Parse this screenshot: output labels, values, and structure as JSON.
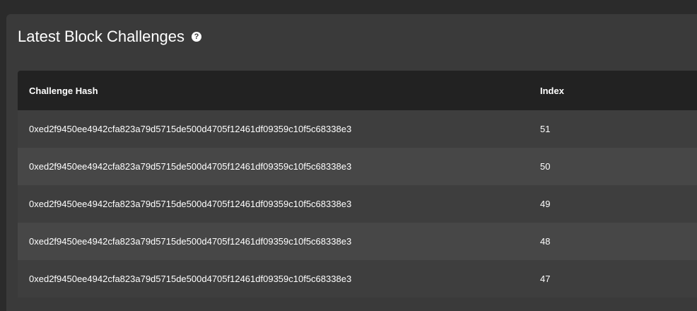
{
  "panel": {
    "title": "Latest Block Challenges",
    "help_icon": "question-circle-icon"
  },
  "table": {
    "columns": [
      "Challenge Hash",
      "Index"
    ],
    "rows": [
      {
        "hash": "0xed2f9450ee4942cfa823a79d5715de500d4705f12461df09359c10f5c68338e3",
        "index": "51"
      },
      {
        "hash": "0xed2f9450ee4942cfa823a79d5715de500d4705f12461df09359c10f5c68338e3",
        "index": "50"
      },
      {
        "hash": "0xed2f9450ee4942cfa823a79d5715de500d4705f12461df09359c10f5c68338e3",
        "index": "49"
      },
      {
        "hash": "0xed2f9450ee4942cfa823a79d5715de500d4705f12461df09359c10f5c68338e3",
        "index": "48"
      },
      {
        "hash": "0xed2f9450ee4942cfa823a79d5715de500d4705f12461df09359c10f5c68338e3",
        "index": "47"
      }
    ]
  }
}
